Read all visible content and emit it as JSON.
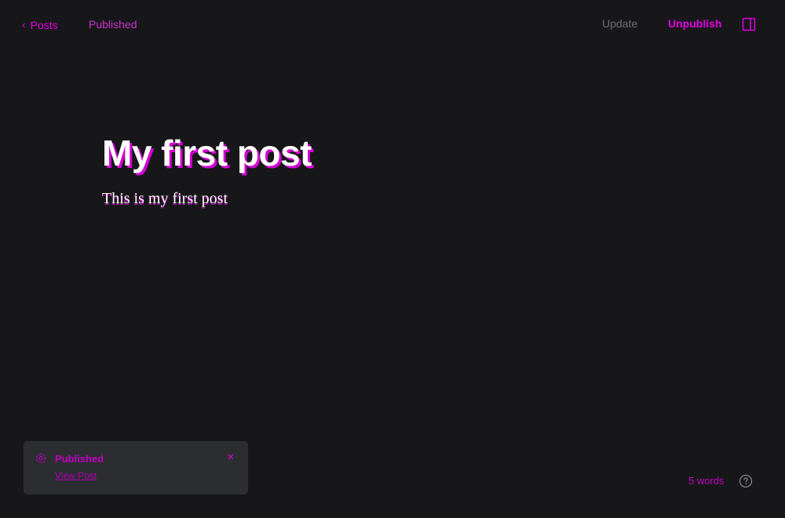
{
  "header": {
    "back_label": "Posts",
    "status": "Published",
    "update_label": "Update",
    "unpublish_label": "Unpublish"
  },
  "editor": {
    "title": "My first post",
    "body": "This is my first post"
  },
  "toast": {
    "title": "Published",
    "link_label": "View Post",
    "close_label": "×"
  },
  "footer": {
    "word_count": "5 words"
  },
  "icons": {
    "back": "chevron-left-icon",
    "panel": "sidebar-toggle-icon",
    "toast": "gear-icon",
    "close": "close-icon",
    "help": "help-circle-icon"
  },
  "colors": {
    "background": "#17171a",
    "accent": "#e000e0",
    "toast_background": "#2c2d31",
    "muted_text": "#6f6f73"
  }
}
